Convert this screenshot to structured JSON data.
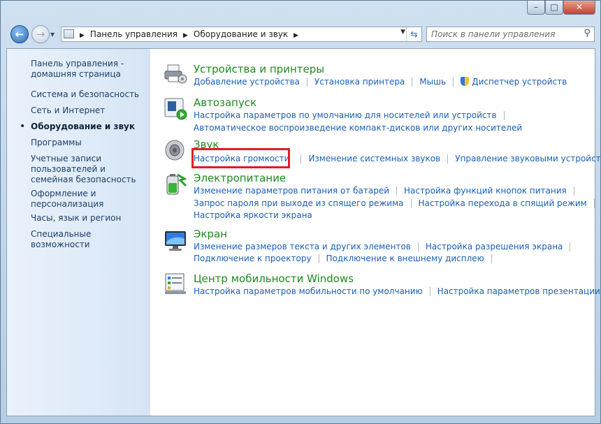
{
  "window": {
    "controls": {
      "minimize": "–",
      "maximize": "□",
      "close": "✕"
    }
  },
  "nav": {
    "breadcrumbs": [
      "Панель управления",
      "Оборудование и звук"
    ],
    "search_placeholder": "Поиск в панели управления"
  },
  "sidebar": {
    "items": [
      "Панель управления - домашняя страница",
      "Система и безопасность",
      "Сеть и Интернет",
      "Оборудование и звук",
      "Программы",
      "Учетные записи пользователей и семейная безопасность",
      "Оформление и персонализация",
      "Часы, язык и регион",
      "Специальные возможности"
    ],
    "active_index": 3
  },
  "categories": [
    {
      "title": "Устройства и принтеры",
      "icon": "printer-icon",
      "lines": [
        [
          "Добавление устройства",
          "Установка принтера",
          "Мышь",
          "Диспетчер устройств"
        ]
      ]
    },
    {
      "title": "Автозапуск",
      "icon": "autoplay-icon",
      "lines": [
        [
          "Настройка параметров по умолчанию для носителей или устройств"
        ],
        [
          "Автоматическое воспроизведение компакт-дисков или других носителей"
        ]
      ]
    },
    {
      "title": "Звук",
      "icon": "speaker-icon",
      "lines": [
        [
          "Настройка громкости",
          "Изменение системных звуков",
          "Управление звуковыми устройствами"
        ]
      ]
    },
    {
      "title": "Электропитание",
      "icon": "battery-icon",
      "lines": [
        [
          "Изменение параметров питания от батарей",
          "Настройка функций кнопок питания"
        ],
        [
          "Запрос пароля при выходе из спящего режима",
          "Настройка перехода в спящий режим"
        ],
        [
          "Настройка яркости экрана"
        ]
      ]
    },
    {
      "title": "Экран",
      "icon": "monitor-icon",
      "lines": [
        [
          "Изменение размеров текста и других элементов",
          "Настройка разрешения экрана"
        ],
        [
          "Подключение к проектору",
          "Подключение к внешнему дисплею"
        ]
      ]
    },
    {
      "title": "Центр мобильности Windows",
      "icon": "mobility-center-icon",
      "lines": [
        [
          "Настройка параметров мобильности по умолчанию",
          "Настройка параметров презентации"
        ]
      ]
    }
  ],
  "highlight": {
    "target": "Настройка громкости",
    "color": "#e31b23"
  },
  "colors": {
    "category_title": "#1d8a1e",
    "link": "#1a5fb4",
    "sidebar_text": "#1e3f66"
  }
}
